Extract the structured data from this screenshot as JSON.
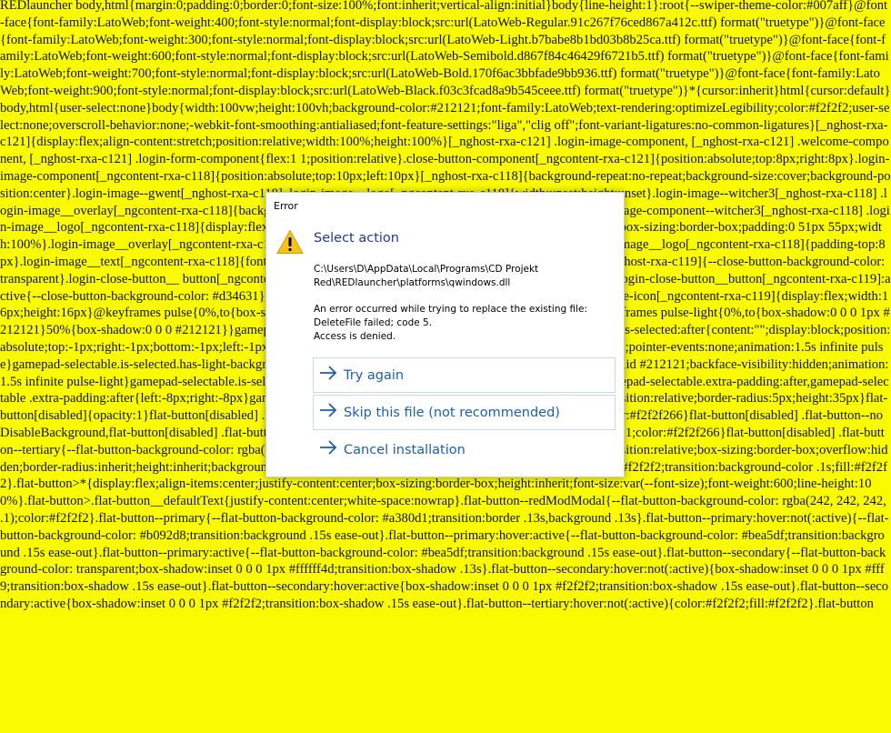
{
  "background": {
    "code_text": "REDlauncher body,html{margin:0;padding:0;border:0;font-size:100%;font:inherit;vertical-align:initial}body{line-height:1}:root{--swiper-theme-color:#007aff}@font-face{font-family:LatoWeb;font-weight:400;font-style:normal;font-display:block;src:url(LatoWeb-Regular.91c267f76ced867a412c.ttf) format(\"truetype\")}@font-face{font-family:LatoWeb;font-weight:300;font-style:normal;font-display:block;src:url(LatoWeb-Light.b7babe8b1bd03b8b25ca.ttf) format(\"truetype\")}@font-face{font-family:LatoWeb;font-weight:600;font-style:normal;font-display:block;src:url(LatoWeb-Semibold.d867f84c46429f6721b5.ttf) format(\"truetype\")}@font-face{font-family:LatoWeb;font-weight:700;font-style:normal;font-display:block;src:url(LatoWeb-Bold.170f6ac3bbfade9bb936.ttf) format(\"truetype\")}@font-face{font-family:LatoWeb;font-weight:900;font-style:normal;font-display:block;src:url(LatoWeb-Black.f03c3fcad8a9b545ceee.ttf) format(\"truetype\")}*{cursor:inherit}html{cursor:default}body,html{user-select:none}body{width:100vw;height:100vh;background-color:#212121;font-family:LatoWeb;text-rendering:optimizeLegibility;color:#f2f2f2;user-select:none;overscroll-behavior:none;-webkit-font-smoothing:antialiased;font-feature-settings:\"liga\",\"clig off\";font-variant-ligatures:no-common-ligatures}[_nghost-rxa-c121]{display:flex;align-content:stretch;position:relative;width:100%;height:100%}[_nghost-rxa-c121] .login-image-component, [_nghost-rxa-c121] .welcome-component, [_nghost-rxa-c121] .login-form-component{flex:1 1;position:relative}.close-button-component[_ngcontent-rxa-c121]{position:absolute;top:8px;right:8px}.login-image-component[_ngcontent-rxa-c118]{position:absolute;top:10px;left:10px}[_nghost-rxa-c118]{background-repeat:no-repeat;background-size:cover;background-position:center}.login-image--gwent[_nghost-rxa-c118] .login-image__logo[_ngcontent-rxa-c118]{width:unset;height:unset}.login-image--witcher3[_nghost-rxa-c118] .login-image__overlay[_ngcontent-rxa-c118]{background:linear-gradient(180deg,transparent,rgba(0,0,0,.7))}.login-image-component--witcher3[_nghost-rxa-c118] .login-image__logo[_ngcontent-rxa-c118]{display:flex;flex-direction:column;align-items:center;justify-content:flex-end;box-sizing:border-box;padding:0 51px 55px;width:100%}.login-image__overlay[_ngcontent-rxa-c118]{display:flex;flex-direction:column;align-items:center}.login-image__logo[_ngcontent-rxa-c118]{padding-top:8px}.login-image__text[_ngcontent-rxa-c118]{font-size:14px;font-weight:400;line-height:21px;text-align:center}[_nghost-rxa-c119]{--close-button-background-color: transparent}.login-close-button__ button[_ngcontent-rxa-c119]:hover{--close-button-background-color: #f2f2f21a}.login-close-button__button[_ngcontent-rxa-c119]:active{--close-button-background-color: #d34631}.login-close-button[_ngcontent-rxa-c119] .login-close-button__close-icon[_ngcontent-rxa-c119]{display:flex;width:16px;height:16px}@keyframes pulse{0%,to{box-shadow:0 0 0 1px #fcee09}50%{box-shadow:0 0 0 #fcee09}}@keyframes pulse-light{0%,to{box-shadow:0 0 0 1px #212121}50%{box-shadow:0 0 0 #212121}}gamepad-selectable{position:relative;display:block}gamepad-selectable.is-selected:after{content:\"\";display:block;position:absolute;top:-1px;right:-1px;bottom:-1px;left:-1px;box-sizing:border-box;border:1px solid #fcee09;border-radius:8px;pointer-events:none;animation:1.5s infinite pulse}gamepad-selectable.is-selected.has-light-background:after,gamepad-selectable.is-selected.dark:after{border:1px solid #212121;backface-visibility:hidden;animation:1.5s infinite pulse-light}gamepad-selectable.is-selected.is-disabled:after{border:1px solid rgba(242,242,242,.4)}gamepad-selectable.extra-padding:after,gamepad-selectable .extra-padding:after{left:-8px;right:-8px}gamepad-selectable a{position:absolute} flat-button{display:block;position:relative;border-radius:5px;height:35px}flat-button[disabled]{opacity:1}flat-button[disabled] .flat-button{--flat-button-background-color: #4a4a4a;opacity:1;color:#f2f2f266}flat-button[disabled] .flat-button--noDisableBackground,flat-button[disabled] .flat-button--secondary{--flat-button-background-color: transparent;opacity:1;color:#f2f2f266}flat-button[disabled] .flat-button--tertiary{--flat-button-background-color: rgba(0, 0, 0, .7);opacity:1;color:#f2f2f266}.flat-button{display:block;position:relative;box-sizing:border-box;overflow:hidden;border-radius:inherit;height:inherit;background-color:var(--flat-button-background-color, rgba(0, 0, 0, .7));color:#f2f2f2;transition:background-color .1s;fill:#f2f2f2}.flat-button>*{display:flex;align-items:center;justify-content:center;box-sizing:border-box;height:inherit;font-size:var(--font-size);font-weight:600;line-height:100%}.flat-button>.flat-button__defaultText{justify-content:center;white-space:nowrap}.flat-button--redModModal{--flat-button-background-color: rgba(242, 242, 242, .1);color:#f2f2f2}.flat-button--primary{--flat-button-background-color: #a380d1;transition:border .13s,background .13s}.flat-button--primary:hover:not(:active){--flat-button-background-color: #b092d8;transition:background .15s ease-out}.flat-button--primary:hover:active{--flat-button-background-color: #bea5df;transition:background .15s ease-out}.flat-button--primary:active{--flat-button-background-color: #bea5df;transition:background .15s ease-out}.flat-button--secondary{--flat-button-background-color: transparent;box-shadow:inset 0 0 0 1px #ffffff4d;transition:box-shadow .13s}.flat-button--secondary:hover:not(:active){box-shadow:inset 0 0 0 1px #fff9;transition:box-shadow .15s ease-out}.flat-button--secondary:hover:active{box-shadow:inset 0 0 0 1px #f2f2f2;transition:box-shadow .15s ease-out}.flat-button--secondary:active{box-shadow:inset 0 0 0 1px #f2f2f2;transition:box-shadow .15s ease-out}.flat-button--tertiary:hover:not(:active){color:#f2f2f2;fill:#f2f2f2}.flat-button",
    "color": "#ffff00",
    "text_color": "#141414"
  },
  "dialog": {
    "window_title": "Error",
    "icon": "warning-icon",
    "heading": "Select action",
    "path_text": "C:\\Users\\D\\AppData\\Local\\Programs\\CD Projekt Red\\REDlauncher\\platforms\\qwindows.dll",
    "error_line1": "An error occurred while trying to replace the existing file:",
    "error_line2": "DeleteFile failed; code 5.",
    "error_line3": "Access is denied.",
    "accent_color": "#1a5fb4",
    "heading_color": "#1f3a93",
    "options": [
      {
        "label": "Try again",
        "icon": "arrow-right-icon"
      },
      {
        "label": "Skip this file (not recommended)",
        "icon": "arrow-right-icon"
      },
      {
        "label": "Cancel installation",
        "icon": "arrow-right-icon"
      }
    ]
  }
}
